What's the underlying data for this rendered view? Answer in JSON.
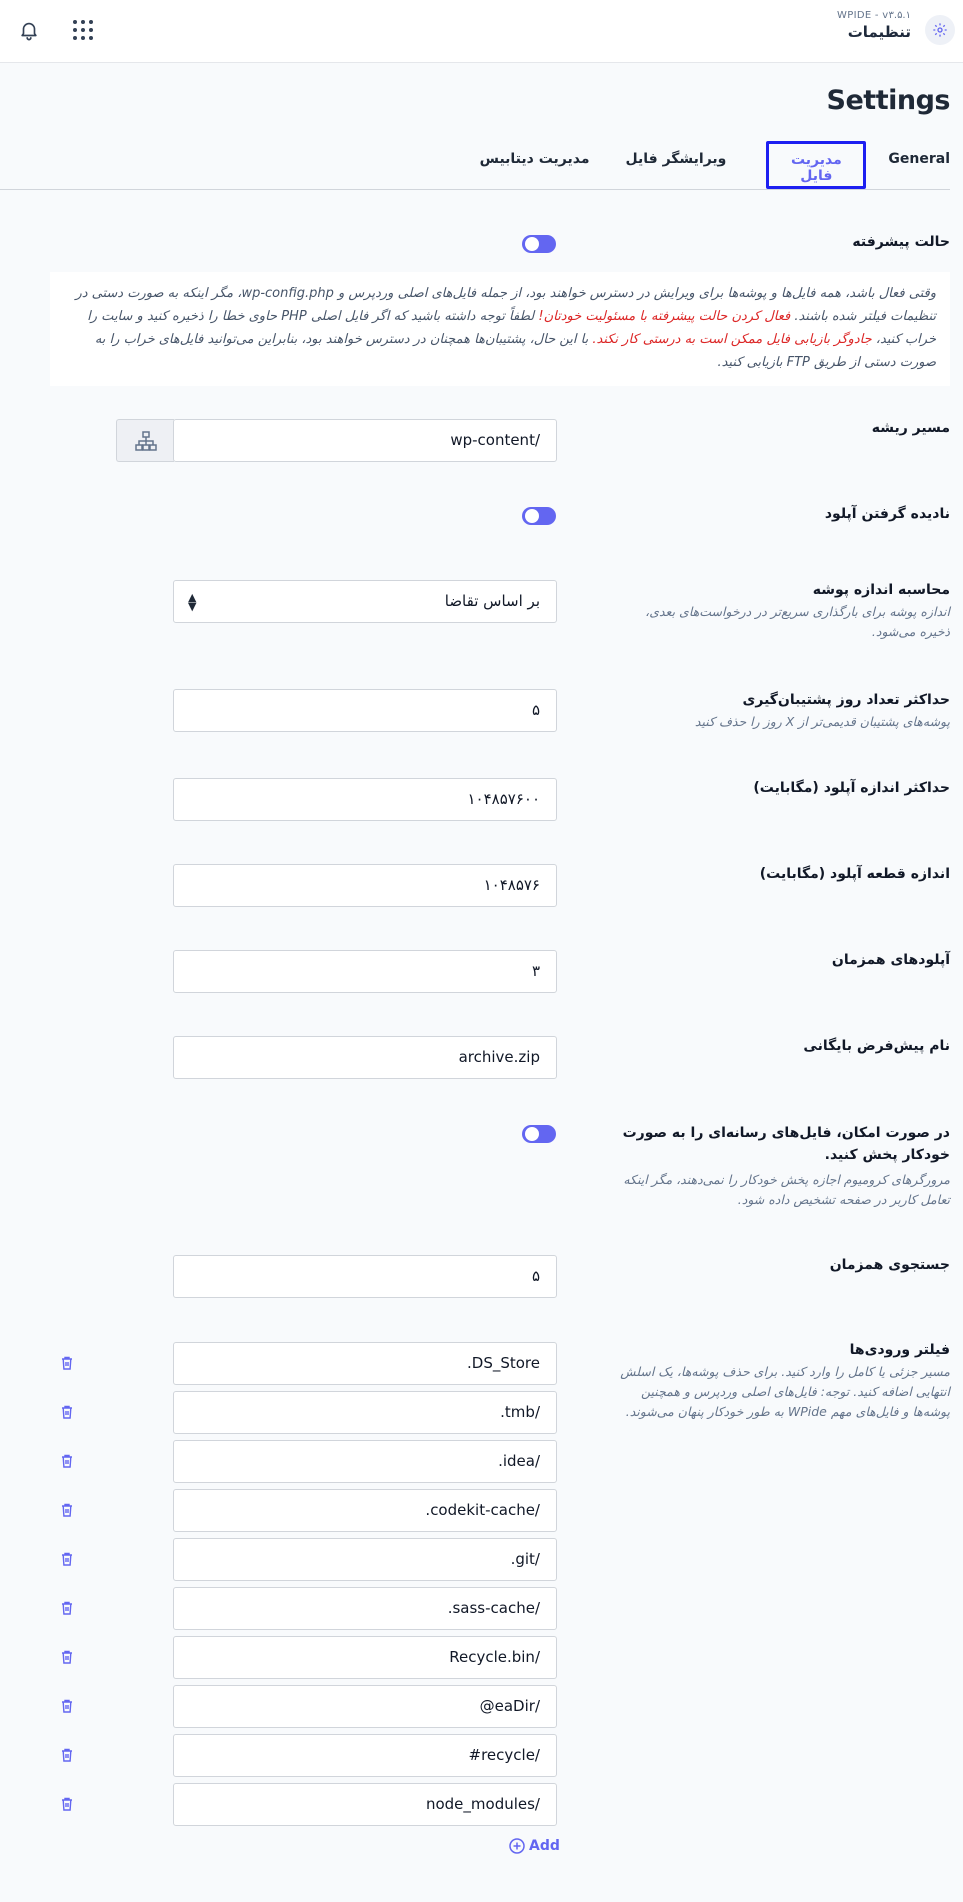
{
  "header": {
    "version": "WPIDE - v۳.۵.۱",
    "title": "تنظیمات",
    "icons": {
      "notifications": "bell-icon",
      "apps": "grid-icon",
      "settings": "gear-icon"
    }
  },
  "page": {
    "title": "Settings"
  },
  "tabs": [
    {
      "label": "General",
      "active": false
    },
    {
      "label": "مدیریت فایل",
      "active": true
    },
    {
      "label": "ویرایشگر فایل",
      "active": false
    },
    {
      "label": "مدیریت دیتابیس",
      "active": false
    }
  ],
  "advanced_mode": {
    "label": "حالت پیشرفته",
    "enabled": true,
    "notice_part1": "وقتی فعال باشد، همه فایل‌ها و پوشه‌ها برای ویرایش در دسترس خواهند بود، از جمله فایل‌های اصلی وردپرس و wp-config.php، مگر اینکه به صورت دستی در تنظیمات فیلتر شده باشند. ",
    "notice_red1": "فعال کردن حالت پیشرفته با مسئولیت خودتان!",
    "notice_part2": " لطفاً توجه داشته باشید که اگر فایل اصلی PHP حاوی خطا را ذخیره کنید و سایت را خراب کنید، ",
    "notice_red2": "جادوگر بازیابی فایل ممکن است به درستی کار نکند.",
    "notice_part3": " با این حال، پشتیبان‌ها همچنان در دسترس خواهند بود، بنابراین می‌توانید فایل‌های خراب را به صورت دستی از طریق FTP بازیابی کنید."
  },
  "root_path": {
    "label": "مسیر ریشه",
    "value": "wp-content/",
    "icon": "sitemap-icon"
  },
  "ignore_uploads": {
    "label": "نادیده گرفتن آپلود",
    "enabled": true
  },
  "folder_size": {
    "label": "محاسبه اندازه پوشه",
    "description": "اندازه پوشه برای بارگذاری سریع‌تر در درخواست‌های بعدی، ذخیره می‌شود.",
    "selected": "بر اساس تقاضا"
  },
  "backup_days": {
    "label": "حداکثر تعداد روز پشتیبان‌گیری",
    "description": "پوشه‌های پشتیبان قدیمی‌تر از X روز را حذف کنید",
    "value": "۵"
  },
  "max_upload": {
    "label": "حداکثر اندازه آپلود (مگابایت)",
    "value": "۱۰۴۸۵۷۶۰۰"
  },
  "chunk_size": {
    "label": "اندازه قطعه آپلود (مگابایت)",
    "value": "۱۰۴۸۵۷۶"
  },
  "concurrent_uploads": {
    "label": "آپلودهای همزمان",
    "value": "۳"
  },
  "archive_name": {
    "label": "نام پیش‌فرض بایگانی",
    "value": "archive.zip"
  },
  "autoplay": {
    "label": "در صورت امکان، فایل‌های رسانه‌ای را به صورت خودکار پخش کنید.",
    "description": "مرورگرهای کرومیوم اجازه پخش خودکار را نمی‌دهند، مگر اینکه تعامل کاربر در صفحه تشخیص داده شود.",
    "enabled": true
  },
  "concurrent_search": {
    "label": "جستجوی همزمان",
    "value": "۵"
  },
  "entry_filters": {
    "label": "فیلتر ورودی‌ها",
    "description": "مسیر جزئی یا کامل را وارد کنید. برای حذف پوشه‌ها، یک اسلش انتهایی اضافه کنید. توجه: فایل‌های اصلی وردپرس و همچنین پوشه‌ها و فایل‌های مهم WPide به طور خودکار پنهان می‌شوند.",
    "items": [
      ".DS_Store",
      ".tmb/",
      ".idea/",
      ".codekit-cache/",
      ".git/",
      ".sass-cache/",
      "Recycle.bin/",
      "@eaDir/",
      "#recycle/",
      "node_modules/"
    ],
    "add_label": "Add"
  },
  "colors": {
    "accent": "#6366f1",
    "danger": "#dc2626",
    "focus": "#1d1ff1"
  }
}
